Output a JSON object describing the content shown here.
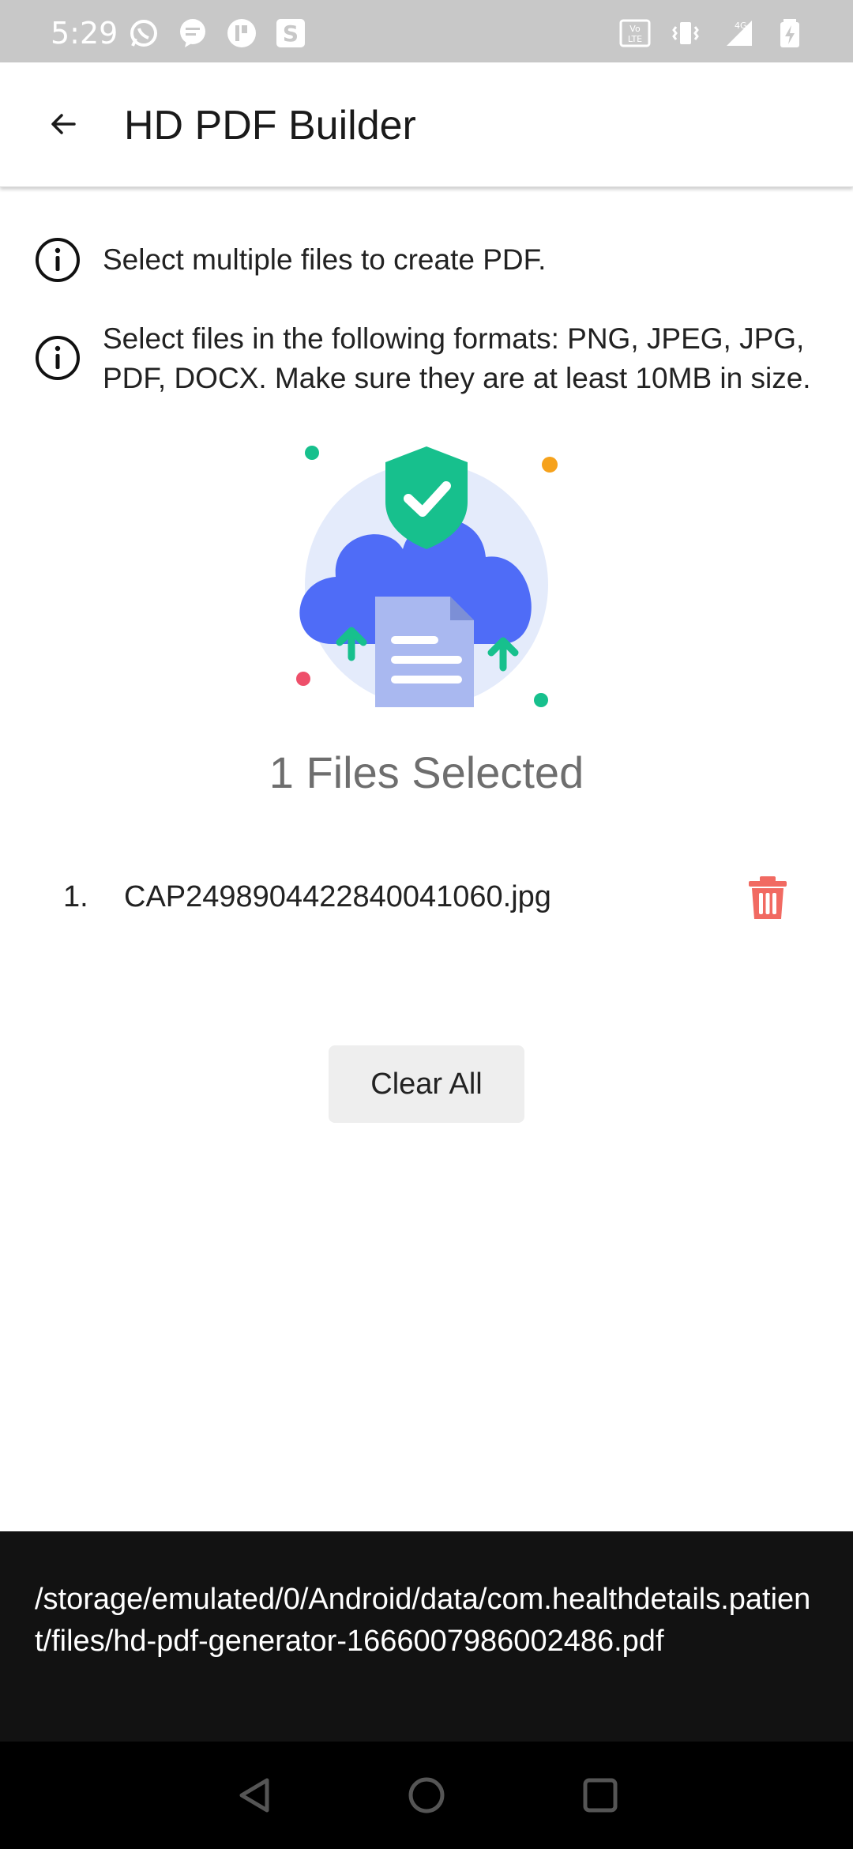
{
  "status_bar": {
    "time": "5:29",
    "left_icons": [
      "whatsapp-icon",
      "message-icon",
      "app-icon",
      "s-app-icon"
    ],
    "right_icons": [
      "volte-icon",
      "vibrate-icon",
      "signal-4g-icon",
      "battery-charging-icon"
    ],
    "network_label": "4G"
  },
  "app_bar": {
    "title": "HD PDF Builder",
    "back_icon": "arrow-left-icon"
  },
  "info": {
    "line1": "Select multiple files to create PDF.",
    "line2": "Select files in the following formats: PNG, JPEG, JPG, PDF, DOCX. Make sure they are at least 10MB in size."
  },
  "illustration": {
    "icon": "cloud-upload-shield-icon",
    "colors": {
      "cloud": "#4f6cf7",
      "circle": "#e4ebfb",
      "shield": "#17c08d",
      "document": "#a9b8f0"
    }
  },
  "files_selected_label": "1 Files Selected",
  "files": [
    {
      "index": "1.",
      "name": "CAP2498904422840041060.jpg"
    }
  ],
  "delete_icon": "trash-icon",
  "delete_color": "#f16a62",
  "clear_all_label": "Clear All",
  "snackbar": {
    "message": "/storage/emulated/0/Android/data/com.healthdetails.patient/files/hd-pdf-generator-1666007986002486.pdf"
  },
  "nav_bar": {
    "buttons": [
      "back-triangle-icon",
      "home-circle-icon",
      "recents-square-icon"
    ]
  }
}
